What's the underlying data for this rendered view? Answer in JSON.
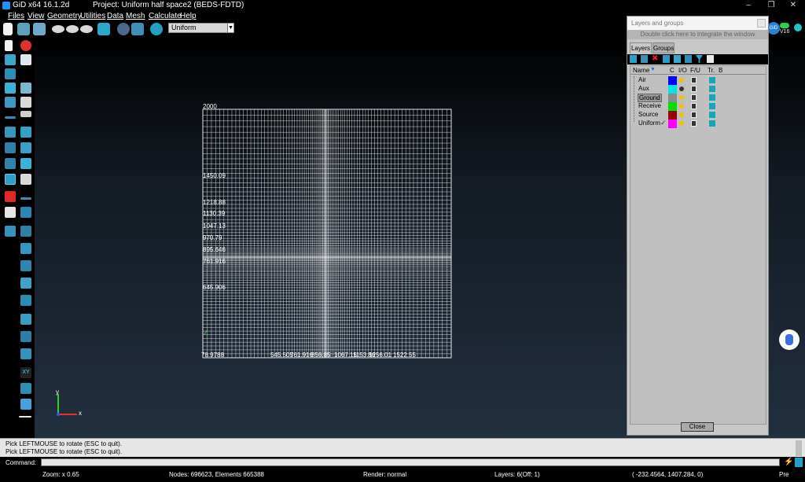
{
  "window": {
    "app_title": "GiD x64 16.1.2d",
    "project_title": "Project: Uniform half space2 (BEDS-FDTD)"
  },
  "menu": [
    "Files",
    "View",
    "Geometry",
    "Utilities",
    "Data",
    "Mesh",
    "Calculate",
    "Help"
  ],
  "toolbar": {
    "render_mode": "Uniform"
  },
  "viewport": {
    "grid_top_label": "2000",
    "left_labels": [
      "1450.09",
      "1218.88",
      "1130.39",
      "1047.13",
      "970.79",
      "895.646",
      "761.916",
      "645.906"
    ],
    "bottom_labels": [
      "78.9788",
      "545.505",
      "761.916",
      "856.85",
      "1067.15",
      "1153.86",
      "1256.01",
      "1522.55"
    ],
    "axis_x": "x",
    "axis_y": "y"
  },
  "layers_panel": {
    "title": "Layers and groups",
    "integrate_hint": "Double click here to integrate the window",
    "tabs": [
      "Layers",
      "Groups"
    ],
    "active_tab": "Layers",
    "headers": {
      "name": "Name",
      "c": "C",
      "io": "I/O",
      "fu": "F/U",
      "tr": "Tr.",
      "b": "B"
    },
    "layers": [
      {
        "name": "Air",
        "color": "#0000ff",
        "selected": false,
        "active": false
      },
      {
        "name": "Aux",
        "color": "#00e5e5",
        "selected": false,
        "active": false
      },
      {
        "name": "Ground",
        "color": "#8c8c8c",
        "selected": true,
        "active": false
      },
      {
        "name": "Receive",
        "color": "#00e000",
        "selected": false,
        "active": false
      },
      {
        "name": "Source",
        "color": "#990000",
        "selected": false,
        "active": false
      },
      {
        "name": "Uniform",
        "color": "#ff00ff",
        "selected": false,
        "active": true
      }
    ],
    "close_label": "Close"
  },
  "messages": [
    "Pick LEFTMOUSE to rotate (ESC to quit).",
    "Pick LEFTMOUSE to rotate (ESC to quit)."
  ],
  "command": {
    "label": "Command:",
    "value": ""
  },
  "status": {
    "zoom": "Zoom: x 0.65",
    "nodes": "Nodes: 696623, Elements 665388",
    "render": "Render: normal",
    "layers": "Layers: 6(Off: 1)",
    "coords": "( -232.4564,  1407.284,  0)",
    "pre": "Pre"
  },
  "badge": "V16"
}
